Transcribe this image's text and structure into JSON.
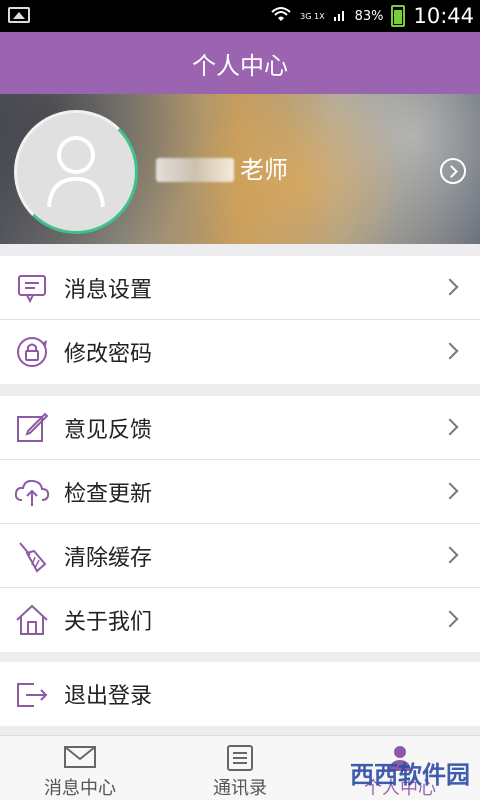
{
  "status": {
    "network": "3G 1X",
    "battery": "83%",
    "time": "10:44"
  },
  "title": "个人中心",
  "profile": {
    "role": "老师"
  },
  "groups": [
    [
      {
        "label": "消息设置",
        "icon": "message-settings-icon"
      },
      {
        "label": "修改密码",
        "icon": "password-lock-icon"
      }
    ],
    [
      {
        "label": "意见反馈",
        "icon": "feedback-edit-icon"
      },
      {
        "label": "检查更新",
        "icon": "cloud-upload-icon"
      },
      {
        "label": "清除缓存",
        "icon": "broom-icon"
      },
      {
        "label": "关于我们",
        "icon": "home-icon"
      }
    ],
    [
      {
        "label": "退出登录",
        "icon": "logout-icon"
      }
    ]
  ],
  "tabs": [
    {
      "label": "消息中心",
      "icon": "mail-icon"
    },
    {
      "label": "通讯录",
      "icon": "contacts-list-icon"
    },
    {
      "label": "个人中心",
      "icon": "person-icon"
    }
  ],
  "watermark": "西西软件园",
  "colors": {
    "accent": "#9b64b0",
    "avatar_ring": "#3ec28a"
  }
}
